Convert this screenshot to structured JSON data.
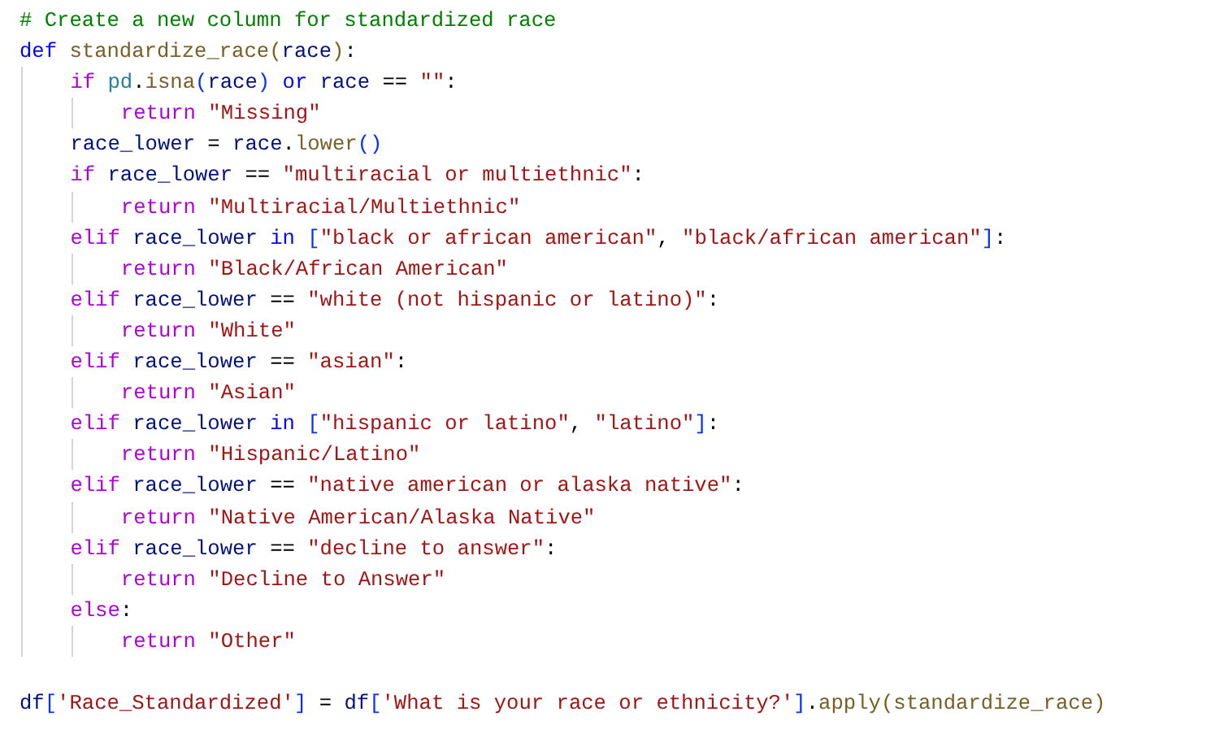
{
  "code": {
    "blocks": [
      [
        {
          "tokens": [
            {
              "kind": "comment",
              "text": "# Create a new column for standardized race"
            }
          ]
        },
        {
          "tokens": [
            {
              "kind": "keyword",
              "text": "def "
            },
            {
              "kind": "func",
              "text": "standardize_race"
            },
            {
              "kind": "paren",
              "text": "("
            },
            {
              "kind": "var",
              "text": "race"
            },
            {
              "kind": "paren",
              "text": ")"
            },
            {
              "kind": "plain",
              "text": ":"
            }
          ],
          "children": [
            {
              "tokens": [
                {
                  "kind": "control",
                  "text": "if "
                },
                {
                  "kind": "module",
                  "text": "pd"
                },
                {
                  "kind": "plain",
                  "text": "."
                },
                {
                  "kind": "func",
                  "text": "isna"
                },
                {
                  "kind": "bracket",
                  "text": "("
                },
                {
                  "kind": "var",
                  "text": "race"
                },
                {
                  "kind": "bracket",
                  "text": ")"
                },
                {
                  "kind": "keyword",
                  "text": " or "
                },
                {
                  "kind": "var",
                  "text": "race"
                },
                {
                  "kind": "plain",
                  "text": " == "
                },
                {
                  "kind": "string",
                  "text": "\"\""
                },
                {
                  "kind": "plain",
                  "text": ":"
                }
              ],
              "children": [
                {
                  "tokens": [
                    {
                      "kind": "control",
                      "text": "return "
                    },
                    {
                      "kind": "string",
                      "text": "\"Missing\""
                    }
                  ]
                }
              ]
            },
            {
              "tokens": [
                {
                  "kind": "var",
                  "text": "race_lower"
                },
                {
                  "kind": "plain",
                  "text": " = "
                },
                {
                  "kind": "var",
                  "text": "race"
                },
                {
                  "kind": "plain",
                  "text": "."
                },
                {
                  "kind": "func",
                  "text": "lower"
                },
                {
                  "kind": "bracket",
                  "text": "()"
                }
              ]
            },
            {
              "tokens": [
                {
                  "kind": "control",
                  "text": "if "
                },
                {
                  "kind": "var",
                  "text": "race_lower"
                },
                {
                  "kind": "plain",
                  "text": " == "
                },
                {
                  "kind": "string",
                  "text": "\"multiracial or multiethnic\""
                },
                {
                  "kind": "plain",
                  "text": ":"
                }
              ],
              "children": [
                {
                  "tokens": [
                    {
                      "kind": "control",
                      "text": "return "
                    },
                    {
                      "kind": "string",
                      "text": "\"Multiracial/Multiethnic\""
                    }
                  ]
                }
              ]
            },
            {
              "tokens": [
                {
                  "kind": "control",
                  "text": "elif "
                },
                {
                  "kind": "var",
                  "text": "race_lower"
                },
                {
                  "kind": "keyword",
                  "text": " in "
                },
                {
                  "kind": "bracket",
                  "text": "["
                },
                {
                  "kind": "string",
                  "text": "\"black or african american\""
                },
                {
                  "kind": "plain",
                  "text": ", "
                },
                {
                  "kind": "string",
                  "text": "\"black/african american\""
                },
                {
                  "kind": "bracket",
                  "text": "]"
                },
                {
                  "kind": "plain",
                  "text": ":"
                }
              ],
              "children": [
                {
                  "tokens": [
                    {
                      "kind": "control",
                      "text": "return "
                    },
                    {
                      "kind": "string",
                      "text": "\"Black/African American\""
                    }
                  ]
                }
              ]
            },
            {
              "tokens": [
                {
                  "kind": "control",
                  "text": "elif "
                },
                {
                  "kind": "var",
                  "text": "race_lower"
                },
                {
                  "kind": "plain",
                  "text": " == "
                },
                {
                  "kind": "string",
                  "text": "\"white (not hispanic or latino)\""
                },
                {
                  "kind": "plain",
                  "text": ":"
                }
              ],
              "children": [
                {
                  "tokens": [
                    {
                      "kind": "control",
                      "text": "return "
                    },
                    {
                      "kind": "string",
                      "text": "\"White\""
                    }
                  ]
                }
              ]
            },
            {
              "tokens": [
                {
                  "kind": "control",
                  "text": "elif "
                },
                {
                  "kind": "var",
                  "text": "race_lower"
                },
                {
                  "kind": "plain",
                  "text": " == "
                },
                {
                  "kind": "string",
                  "text": "\"asian\""
                },
                {
                  "kind": "plain",
                  "text": ":"
                }
              ],
              "children": [
                {
                  "tokens": [
                    {
                      "kind": "control",
                      "text": "return "
                    },
                    {
                      "kind": "string",
                      "text": "\"Asian\""
                    }
                  ]
                }
              ]
            },
            {
              "tokens": [
                {
                  "kind": "control",
                  "text": "elif "
                },
                {
                  "kind": "var",
                  "text": "race_lower"
                },
                {
                  "kind": "keyword",
                  "text": " in "
                },
                {
                  "kind": "bracket",
                  "text": "["
                },
                {
                  "kind": "string",
                  "text": "\"hispanic or latino\""
                },
                {
                  "kind": "plain",
                  "text": ", "
                },
                {
                  "kind": "string",
                  "text": "\"latino\""
                },
                {
                  "kind": "bracket",
                  "text": "]"
                },
                {
                  "kind": "plain",
                  "text": ":"
                }
              ],
              "children": [
                {
                  "tokens": [
                    {
                      "kind": "control",
                      "text": "return "
                    },
                    {
                      "kind": "string",
                      "text": "\"Hispanic/Latino\""
                    }
                  ]
                }
              ]
            },
            {
              "tokens": [
                {
                  "kind": "control",
                  "text": "elif "
                },
                {
                  "kind": "var",
                  "text": "race_lower"
                },
                {
                  "kind": "plain",
                  "text": " == "
                },
                {
                  "kind": "string",
                  "text": "\"native american or alaska native\""
                },
                {
                  "kind": "plain",
                  "text": ":"
                }
              ],
              "children": [
                {
                  "tokens": [
                    {
                      "kind": "control",
                      "text": "return "
                    },
                    {
                      "kind": "string",
                      "text": "\"Native American/Alaska Native\""
                    }
                  ]
                }
              ]
            },
            {
              "tokens": [
                {
                  "kind": "control",
                  "text": "elif "
                },
                {
                  "kind": "var",
                  "text": "race_lower"
                },
                {
                  "kind": "plain",
                  "text": " == "
                },
                {
                  "kind": "string",
                  "text": "\"decline to answer\""
                },
                {
                  "kind": "plain",
                  "text": ":"
                }
              ],
              "children": [
                {
                  "tokens": [
                    {
                      "kind": "control",
                      "text": "return "
                    },
                    {
                      "kind": "string",
                      "text": "\"Decline to Answer\""
                    }
                  ]
                }
              ]
            },
            {
              "tokens": [
                {
                  "kind": "control",
                  "text": "else"
                },
                {
                  "kind": "plain",
                  "text": ":"
                }
              ],
              "children": [
                {
                  "tokens": [
                    {
                      "kind": "control",
                      "text": "return "
                    },
                    {
                      "kind": "string",
                      "text": "\"Other\""
                    }
                  ]
                }
              ]
            }
          ]
        }
      ],
      [
        {
          "tokens": [
            {
              "kind": "var",
              "text": "df"
            },
            {
              "kind": "bracket",
              "text": "["
            },
            {
              "kind": "string",
              "text": "'Race_Standardized'"
            },
            {
              "kind": "bracket",
              "text": "]"
            },
            {
              "kind": "plain",
              "text": " = "
            },
            {
              "kind": "var",
              "text": "df"
            },
            {
              "kind": "bracket",
              "text": "["
            },
            {
              "kind": "string",
              "text": "'What is your race or ethnicity?'"
            },
            {
              "kind": "bracket",
              "text": "]"
            },
            {
              "kind": "plain",
              "text": "."
            },
            {
              "kind": "func",
              "text": "apply"
            },
            {
              "kind": "paren",
              "text": "("
            },
            {
              "kind": "func",
              "text": "standardize_race"
            },
            {
              "kind": "paren",
              "text": ")"
            }
          ]
        }
      ]
    ]
  }
}
